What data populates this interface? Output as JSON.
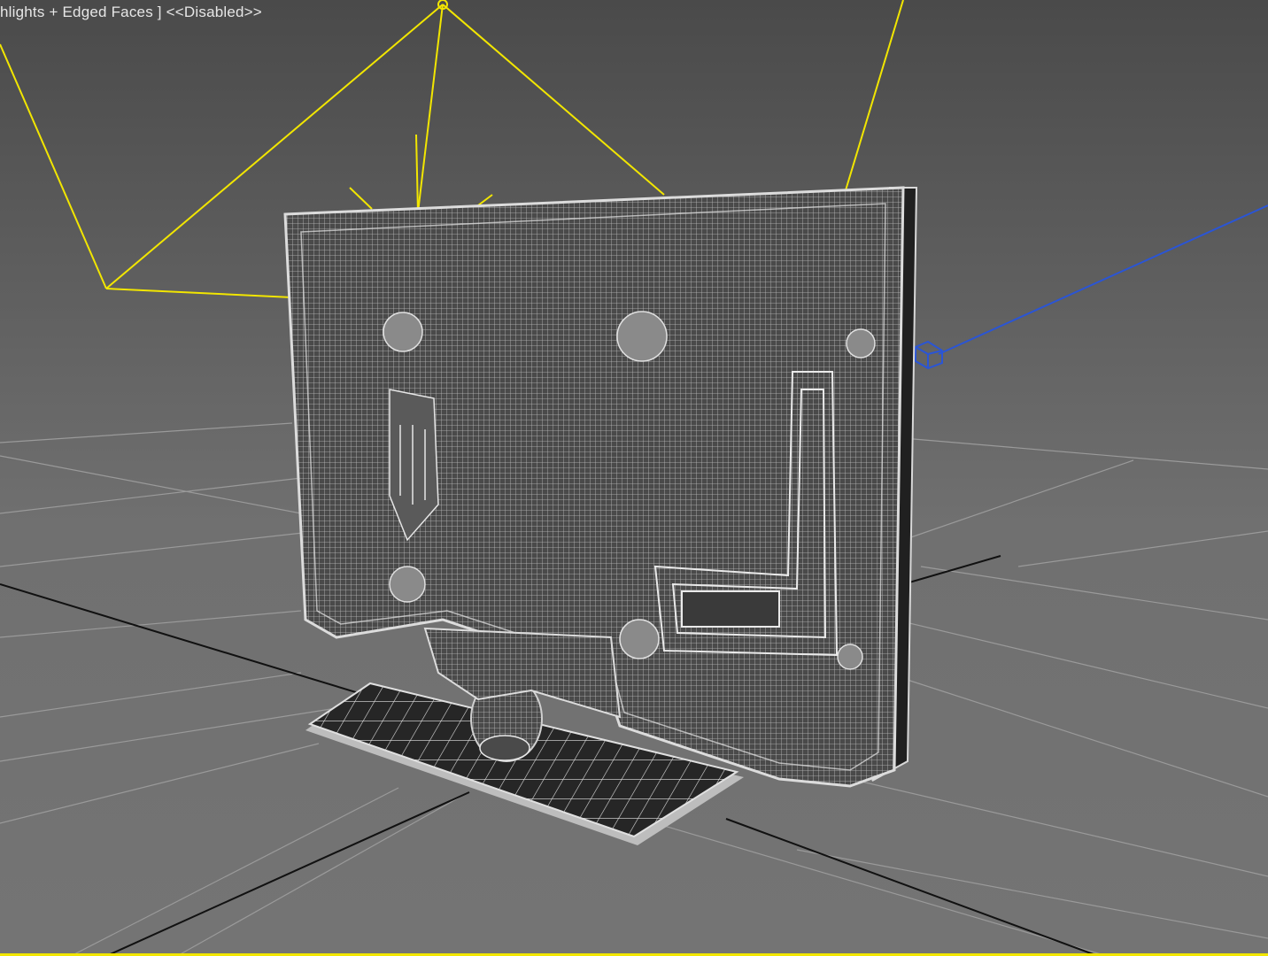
{
  "viewport": {
    "label": "hlights + Edged Faces ] <<Disabled>>",
    "active_border_color": "#f2e600"
  },
  "scene": {
    "light_color": "#f2e600",
    "camera_color": "#2a55d6",
    "grid_color": "#9a9a9a",
    "axis_color": "#111111",
    "wire_color": "#cfcfcf",
    "model_shell_color": "#4e4e4e",
    "objects": [
      "tv-model",
      "tv-stand",
      "spot-light",
      "camera-target"
    ]
  }
}
